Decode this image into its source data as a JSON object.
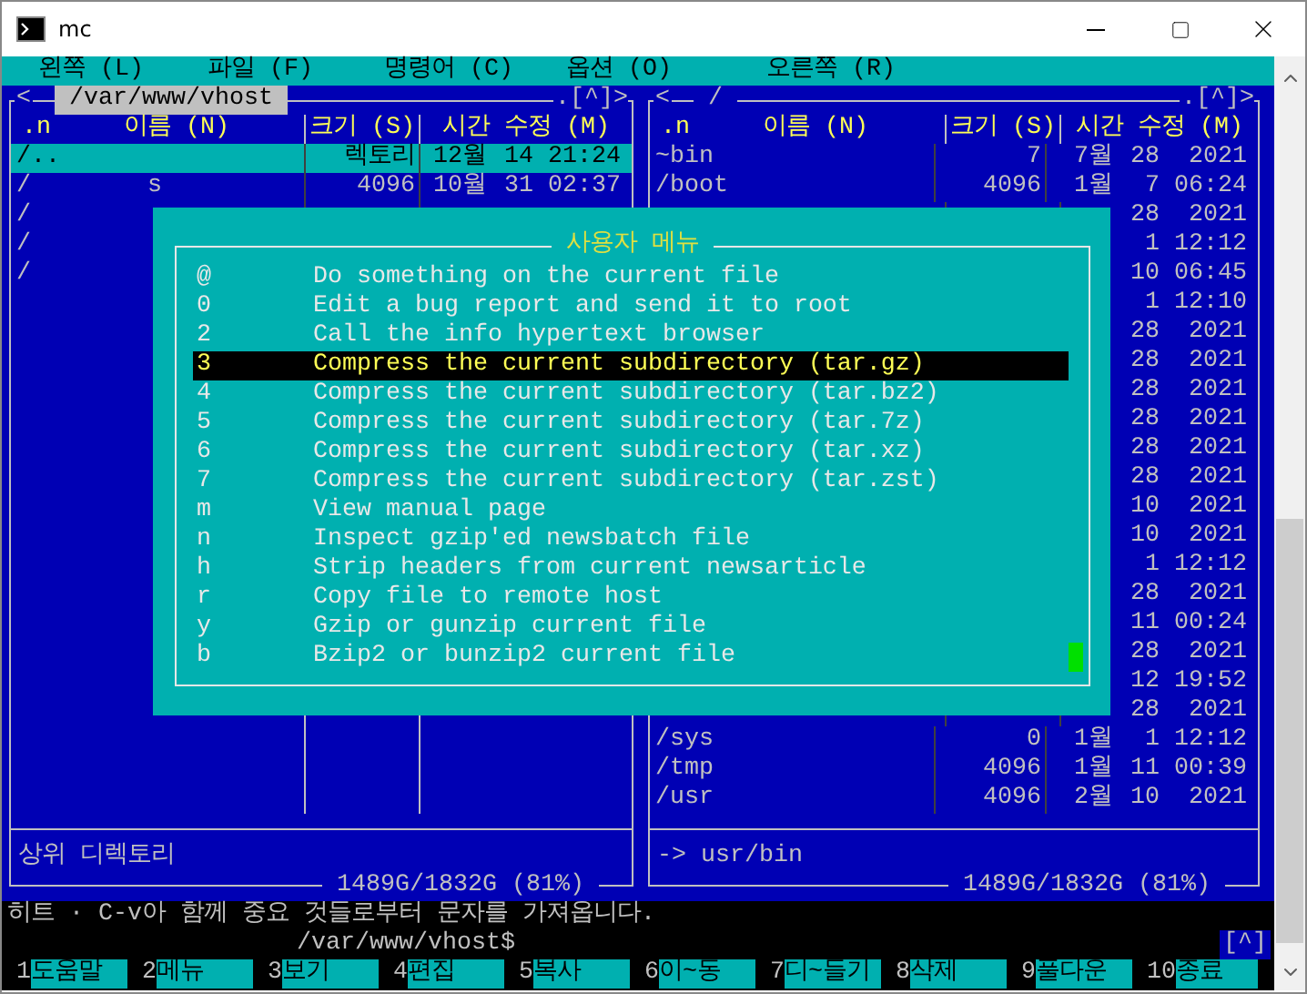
{
  "window": {
    "title": "mc"
  },
  "menu_bar": [
    "왼쪽 (L)",
    "파일 (F)",
    "명령어 (C)",
    "옵션 (O)",
    "오른쪽 (R)"
  ],
  "panels": [
    {
      "active": true,
      "nav_left": "<",
      "path": "/var/www/vhost",
      "nav_right": ".[^]>",
      "columns": [
        ".n",
        "이름 (N)",
        "크기 (S)",
        "시간 수정 (M)"
      ],
      "rows": [
        {
          "name": "/..",
          "size": "렉토리",
          "month": "12월",
          "day": "14",
          "time": "21:24",
          "selected": true
        },
        {
          "name": "/        s",
          "size": "4096",
          "month": "10월",
          "day": "31",
          "time": "02:37",
          "selected": false
        },
        {
          "name": "/",
          "selected": false
        },
        {
          "name": "/",
          "selected": false
        },
        {
          "name": "/",
          "selected": false
        }
      ],
      "mini_status": "상위 디렉토리",
      "disk_usage": "1489G/1832G (81%)"
    },
    {
      "active": false,
      "nav_left": "<",
      "path": "/",
      "nav_right": ".[^]>",
      "columns": [
        ".n",
        "이름 (N)",
        "크기 (S)",
        "시간 수정 (M)"
      ],
      "rows": [
        {
          "name": "~bin",
          "size": "7",
          "month": "7월",
          "day": "28",
          "time": "2021",
          "selected": false
        },
        {
          "name": "/boot",
          "size": "4096",
          "month": "1월",
          "day": "7",
          "time": "06:24",
          "selected": false
        },
        {
          "day": "28",
          "time": "2021",
          "selected": false
        },
        {
          "day": "1",
          "time": "12:12",
          "selected": false
        },
        {
          "day": "10",
          "time": "06:45",
          "selected": false
        },
        {
          "day": "1",
          "time": "12:10",
          "selected": false
        },
        {
          "day": "28",
          "time": "2021",
          "selected": false
        },
        {
          "day": "28",
          "time": "2021",
          "selected": false
        },
        {
          "day": "28",
          "time": "2021",
          "selected": false
        },
        {
          "day": "28",
          "time": "2021",
          "selected": false
        },
        {
          "day": "28",
          "time": "2021",
          "selected": false
        },
        {
          "day": "28",
          "time": "2021",
          "selected": false
        },
        {
          "day": "10",
          "time": "2021",
          "selected": false
        },
        {
          "day": "10",
          "time": "2021",
          "selected": false
        },
        {
          "day": "1",
          "time": "12:12",
          "selected": false
        },
        {
          "day": "28",
          "time": "2021",
          "selected": false
        },
        {
          "day": "11",
          "time": "00:24",
          "selected": false
        },
        {
          "day": "28",
          "time": "2021",
          "selected": false
        },
        {
          "day": "12",
          "time": "19:52",
          "selected": false
        },
        {
          "day": "28",
          "time": "2021",
          "selected": false
        },
        {
          "name": "/sys",
          "size": "0",
          "month": "1월",
          "day": "1",
          "time": "12:12",
          "selected": false
        },
        {
          "name": "/tmp",
          "size": "4096",
          "month": "1월",
          "day": "11",
          "time": "00:39",
          "selected": false
        },
        {
          "name": "/usr",
          "size": "4096",
          "month": "2월",
          "day": "10",
          "time": "2021",
          "selected": false
        }
      ],
      "mini_status": "-> usr/bin",
      "disk_usage": "1489G/1832G (81%)"
    }
  ],
  "user_menu": {
    "title": "사용자 메뉴",
    "items": [
      {
        "key": "@",
        "label": "Do something on the current file",
        "selected": false
      },
      {
        "key": "0",
        "label": "Edit a bug report and send it to root",
        "selected": false
      },
      {
        "key": "2",
        "label": "Call the info hypertext browser",
        "selected": false
      },
      {
        "key": "3",
        "label": "Compress the current subdirectory (tar.gz)",
        "selected": true
      },
      {
        "key": "4",
        "label": "Compress the current subdirectory (tar.bz2)",
        "selected": false
      },
      {
        "key": "5",
        "label": "Compress the current subdirectory (tar.7z)",
        "selected": false
      },
      {
        "key": "6",
        "label": "Compress the current subdirectory (tar.xz)",
        "selected": false
      },
      {
        "key": "7",
        "label": "Compress the current subdirectory (tar.zst)",
        "selected": false
      },
      {
        "key": "m",
        "label": "View manual page",
        "selected": false
      },
      {
        "key": "n",
        "label": "Inspect gzip'ed newsbatch file",
        "selected": false
      },
      {
        "key": "h",
        "label": "Strip headers from current newsarticle",
        "selected": false
      },
      {
        "key": "r",
        "label": "Copy file to remote host",
        "selected": false
      },
      {
        "key": "y",
        "label": "Gzip or gunzip current file",
        "selected": false
      },
      {
        "key": "b",
        "label": "Bzip2 or bunzip2 current file",
        "selected": false
      }
    ]
  },
  "hint": "히트 · C-v아 함께 중요 것들로부터 문자를 가져옵니다.",
  "command_line": {
    "prompt": "/var/www/vhost$",
    "toggle": "[^]"
  },
  "function_keys": [
    {
      "number": "1",
      "label": "도움말"
    },
    {
      "number": "2",
      "label": "메뉴"
    },
    {
      "number": "3",
      "label": "보기"
    },
    {
      "number": "4",
      "label": "편집"
    },
    {
      "number": "5",
      "label": "복사"
    },
    {
      "number": "6",
      "label": "이~동"
    },
    {
      "number": "7",
      "label": "디~들기"
    },
    {
      "number": "8",
      "label": "삭제"
    },
    {
      "number": "9",
      "label": "풀다운"
    },
    {
      "number": "10",
      "label": "종료"
    }
  ]
}
